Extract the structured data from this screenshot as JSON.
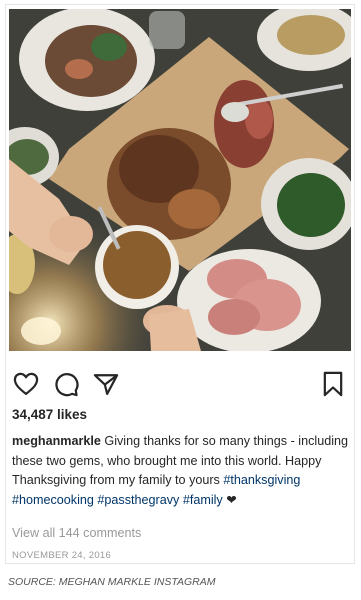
{
  "photo": {
    "icon": "thanksgiving-table-photo"
  },
  "actions": {
    "like_icon": "heart-icon",
    "comment_icon": "comment-icon",
    "share_icon": "share-icon",
    "save_icon": "bookmark-icon"
  },
  "likes": "34,487 likes",
  "caption": {
    "username": "meghanmarkle",
    "text": " Giving thanks for so many things - including these two gems, who brought me into this world. Happy Thanksgiving from my family to yours ",
    "hashtags": [
      "#thanksgiving",
      "#homecooking",
      "#passthegravy",
      "#family"
    ],
    "heart": "❤"
  },
  "comments_link": "View all 144 comments",
  "date": "NOVEMBER 24, 2016",
  "source": "SOURCE: MEGHAN MARKLE INSTAGRAM",
  "colors": {
    "hashtag": "#003569",
    "muted": "#999999",
    "text": "#262626"
  }
}
